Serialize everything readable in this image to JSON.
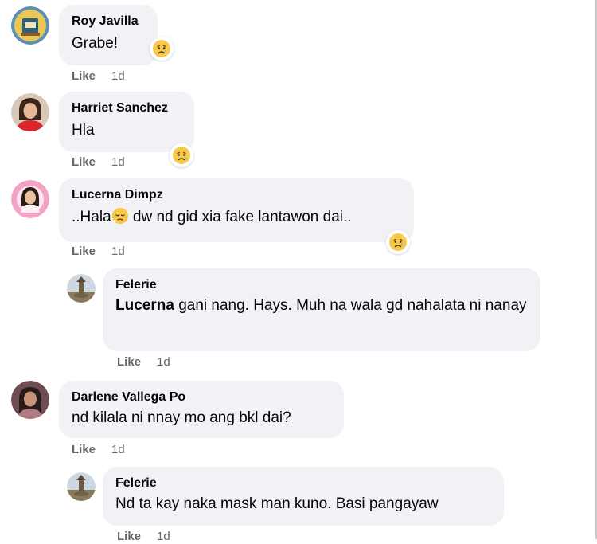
{
  "comments": [
    {
      "author": "Roy Javilla",
      "text": "Grabe!",
      "like_label": "Like",
      "time": "1d"
    },
    {
      "author": "Harriet Sanchez",
      "text": "Hla",
      "like_label": "Like",
      "time": "1d"
    },
    {
      "author": "Lucerna Dimpz",
      "text_before_emoji": "..Hala",
      "text_after_emoji": " dw nd gid xia fake lantawon dai..",
      "like_label": "Like",
      "time": "1d"
    },
    {
      "author": "Felerie",
      "mention": "Lucerna",
      "text": " gani nang. Hays. Muh na wala gd nahalata ni nanay",
      "like_label": "Like",
      "time": "1d"
    },
    {
      "author": "Darlene Vallega Po",
      "text": "nd kilala ni nnay mo ang bkl dai?",
      "like_label": "Like",
      "time": "1d"
    },
    {
      "author": "Felerie",
      "text": "Nd ta kay naka mask man kuno. Basi pangayaw",
      "like_label": "Like",
      "time": "1d"
    }
  ],
  "icons": {
    "sad_reaction": "sad-face-with-tear",
    "pensive_emoji": "pensive-face"
  },
  "colors": {
    "bubble": "#f0f2f5",
    "meta_text": "#65676b",
    "reaction_face": "#f7c84a"
  }
}
